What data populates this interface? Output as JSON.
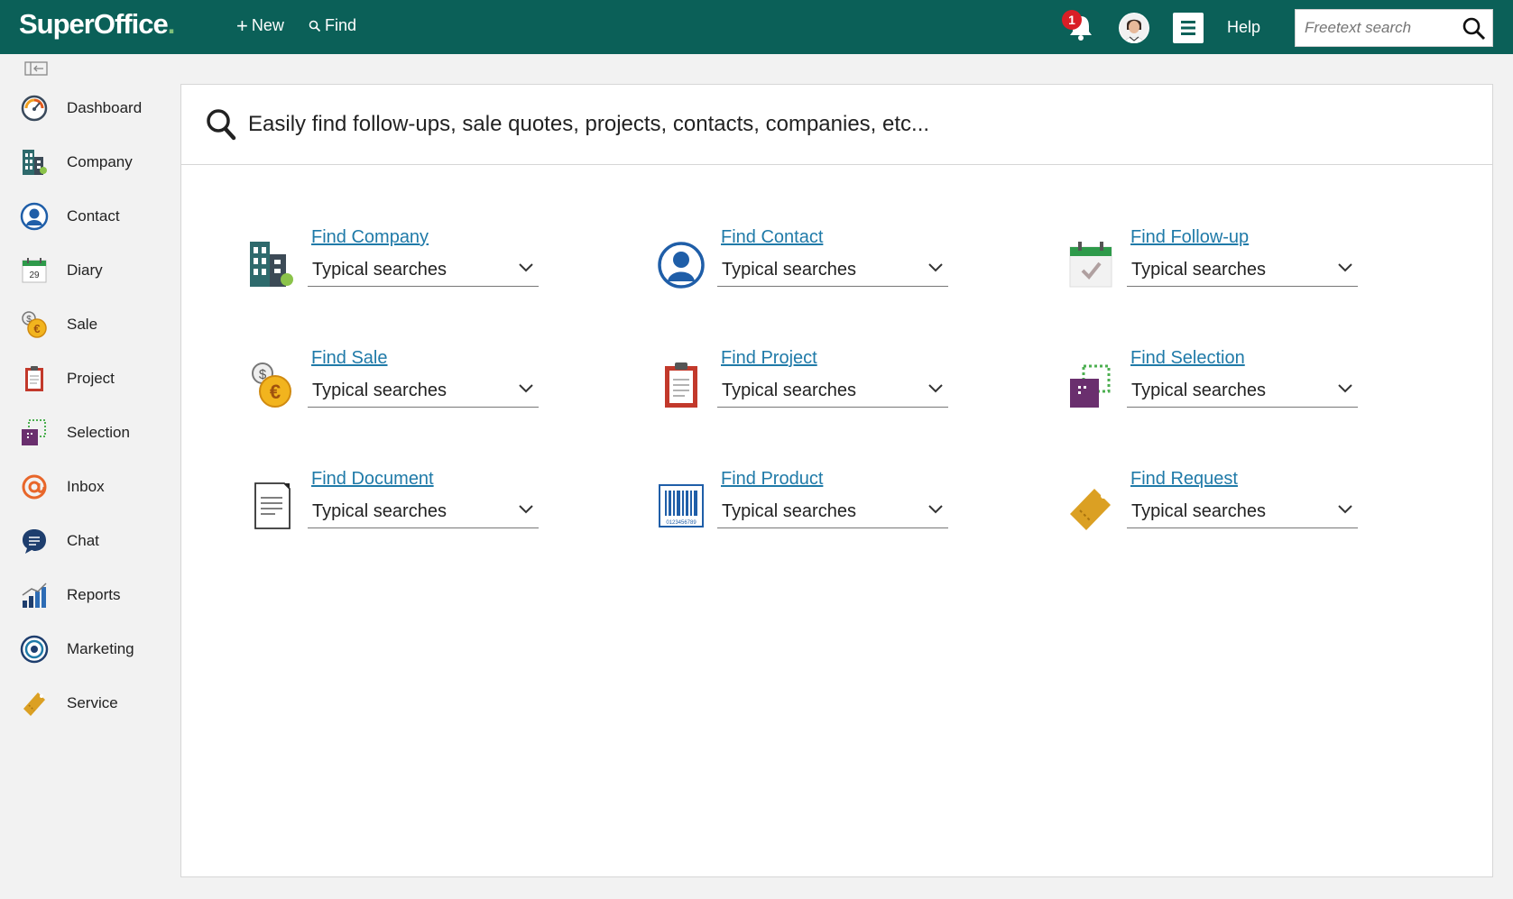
{
  "app": {
    "logo": "SuperOffice",
    "logo_dot": "."
  },
  "topbar": {
    "new_label": "New",
    "find_label": "Find",
    "notification_count": "1",
    "help_label": "Help",
    "search_placeholder": "Freetext search",
    "bg_color": "#0b6058"
  },
  "sidebar": {
    "items": [
      {
        "label": "Dashboard",
        "icon": "dashboard-icon"
      },
      {
        "label": "Company",
        "icon": "company-icon"
      },
      {
        "label": "Contact",
        "icon": "contact-icon"
      },
      {
        "label": "Diary",
        "icon": "diary-icon",
        "icon_text": "29"
      },
      {
        "label": "Sale",
        "icon": "sale-icon"
      },
      {
        "label": "Project",
        "icon": "project-icon"
      },
      {
        "label": "Selection",
        "icon": "selection-icon"
      },
      {
        "label": "Inbox",
        "icon": "inbox-icon"
      },
      {
        "label": "Chat",
        "icon": "chat-icon"
      },
      {
        "label": "Reports",
        "icon": "reports-icon"
      },
      {
        "label": "Marketing",
        "icon": "marketing-icon"
      },
      {
        "label": "Service",
        "icon": "service-icon"
      }
    ]
  },
  "main": {
    "header": "Easily find follow-ups, sale quotes, projects, contacts, companies, etc...",
    "cards": [
      {
        "link": "Find Company",
        "select": "Typical searches",
        "icon": "company-icon"
      },
      {
        "link": "Find Contact",
        "select": "Typical searches",
        "icon": "contact-icon"
      },
      {
        "link": "Find Follow-up",
        "select": "Typical searches",
        "icon": "follow-up-icon"
      },
      {
        "link": "Find Sale",
        "select": "Typical searches",
        "icon": "sale-icon"
      },
      {
        "link": "Find Project",
        "select": "Typical searches",
        "icon": "project-icon"
      },
      {
        "link": "Find Selection",
        "select": "Typical searches",
        "icon": "selection-icon"
      },
      {
        "link": "Find Document",
        "select": "Typical searches",
        "icon": "document-icon"
      },
      {
        "link": "Find Product",
        "select": "Typical searches",
        "icon": "product-barcode-icon",
        "icon_text": "0123456789"
      },
      {
        "link": "Find Request",
        "select": "Typical searches",
        "icon": "request-ticket-icon"
      }
    ]
  }
}
